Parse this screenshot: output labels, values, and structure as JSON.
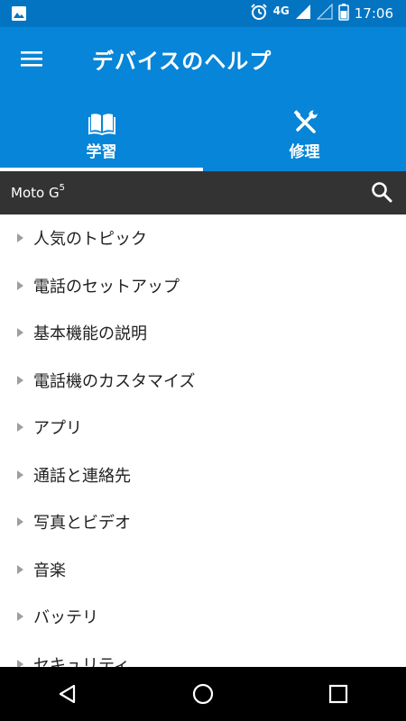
{
  "status_bar": {
    "network": "4G",
    "time": "17:06"
  },
  "app_bar": {
    "title": "デバイスのヘルプ"
  },
  "tabs": [
    {
      "label": "学習",
      "icon": "book-icon",
      "selected": true
    },
    {
      "label": "修理",
      "icon": "wrench-screwdriver-icon",
      "selected": false
    }
  ],
  "device": {
    "name": "Moto G",
    "superscript": "5"
  },
  "topics": [
    {
      "label": "人気のトピック"
    },
    {
      "label": "電話のセットアップ"
    },
    {
      "label": "基本機能の説明"
    },
    {
      "label": "電話機のカスタマイズ"
    },
    {
      "label": "アプリ"
    },
    {
      "label": "通話と連絡先"
    },
    {
      "label": "写真とビデオ"
    },
    {
      "label": "音楽"
    },
    {
      "label": "バッテリ"
    },
    {
      "label": "セキュリティ"
    }
  ]
}
